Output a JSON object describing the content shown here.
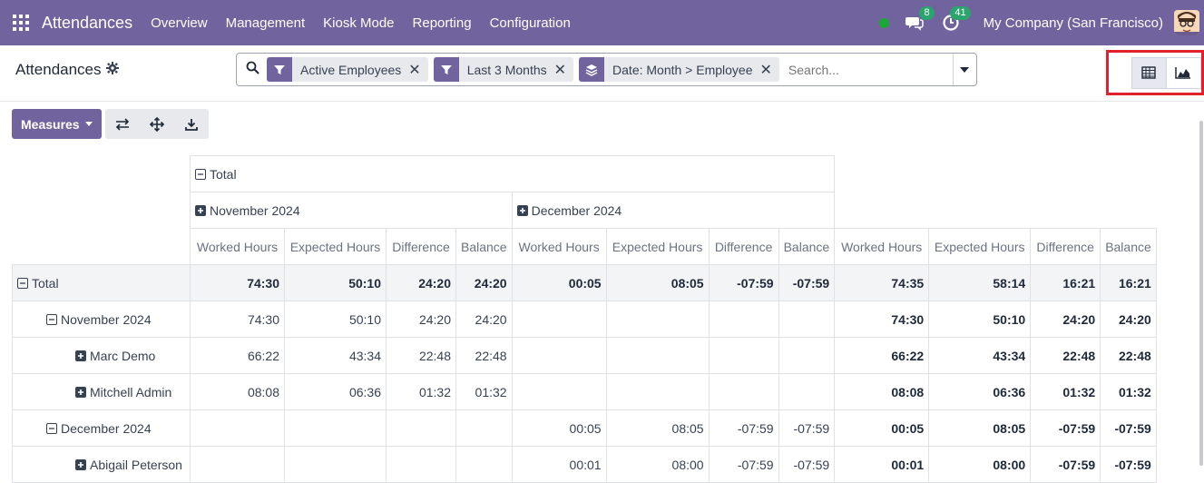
{
  "navbar": {
    "app_name": "Attendances",
    "menu": [
      "Overview",
      "Management",
      "Kiosk Mode",
      "Reporting",
      "Configuration"
    ],
    "messages_count": "8",
    "activities_count": "41",
    "company": "My Company (San Francisco)"
  },
  "control": {
    "breadcrumb": "Attendances",
    "facets": [
      {
        "label": "Active Employees",
        "icon": "filter-icon"
      },
      {
        "label": "Last 3 Months",
        "icon": "filter-icon"
      },
      {
        "label": "Date: Month > Employee",
        "icon": "group-by-icon"
      }
    ],
    "search_placeholder": "Search..."
  },
  "toolbar": {
    "measures_label": "Measures"
  },
  "pivot": {
    "col_total": "Total",
    "col_groups": [
      "November 2024",
      "December 2024"
    ],
    "measures": [
      "Worked Hours",
      "Expected Hours",
      "Difference",
      "Balance"
    ],
    "rows": [
      {
        "label": "Total",
        "level": 0,
        "icon": "minus",
        "values": [
          "74:30",
          "50:10",
          "24:20",
          "24:20",
          "00:05",
          "08:05",
          "-07:59",
          "-07:59",
          "74:35",
          "58:14",
          "16:21",
          "16:21"
        ],
        "bold": true
      },
      {
        "label": "November 2024",
        "level": 1,
        "icon": "minus",
        "values": [
          "74:30",
          "50:10",
          "24:20",
          "24:20",
          "",
          "",
          "",
          "",
          "74:30",
          "50:10",
          "24:20",
          "24:20"
        ],
        "bold": false
      },
      {
        "label": "Marc Demo",
        "level": 2,
        "icon": "plus",
        "values": [
          "66:22",
          "43:34",
          "22:48",
          "22:48",
          "",
          "",
          "",
          "",
          "66:22",
          "43:34",
          "22:48",
          "22:48"
        ],
        "bold": false
      },
      {
        "label": "Mitchell Admin",
        "level": 2,
        "icon": "plus",
        "values": [
          "08:08",
          "06:36",
          "01:32",
          "01:32",
          "",
          "",
          "",
          "",
          "08:08",
          "06:36",
          "01:32",
          "01:32"
        ],
        "bold": false
      },
      {
        "label": "December 2024",
        "level": 1,
        "icon": "minus",
        "values": [
          "",
          "",
          "",
          "",
          "00:05",
          "08:05",
          "-07:59",
          "-07:59",
          "00:05",
          "08:05",
          "-07:59",
          "-07:59"
        ],
        "bold": false
      },
      {
        "label": "Abigail Peterson",
        "level": 2,
        "icon": "plus",
        "values": [
          "",
          "",
          "",
          "",
          "00:01",
          "08:00",
          "-07:59",
          "-07:59",
          "00:01",
          "08:00",
          "-07:59",
          "-07:59"
        ],
        "bold": false
      }
    ]
  }
}
